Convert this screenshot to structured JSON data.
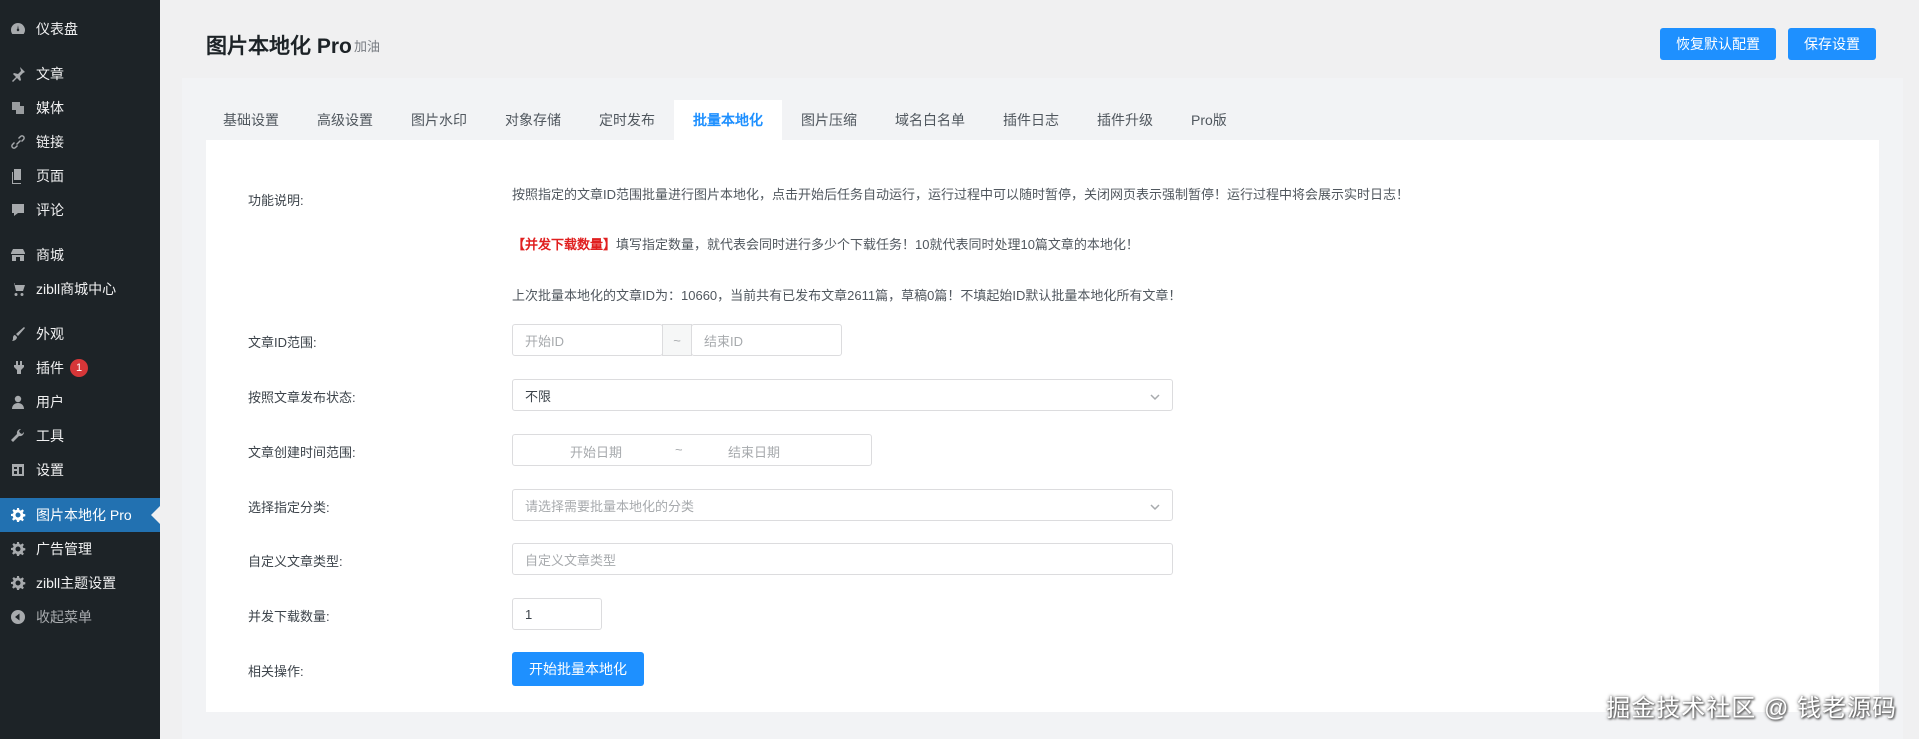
{
  "sidebar": {
    "items": [
      {
        "label": "仪表盘",
        "icon": "dashboard-icon"
      },
      {
        "label": "文章",
        "icon": "pin-icon"
      },
      {
        "label": "媒体",
        "icon": "media-icon"
      },
      {
        "label": "链接",
        "icon": "link-icon"
      },
      {
        "label": "页面",
        "icon": "page-icon"
      },
      {
        "label": "评论",
        "icon": "comment-icon"
      },
      {
        "label": "商城",
        "icon": "store-icon"
      },
      {
        "label": "zibll商城中心",
        "icon": "cart-icon"
      },
      {
        "label": "外观",
        "icon": "brush-icon"
      },
      {
        "label": "插件",
        "icon": "plugin-icon",
        "badge": "1"
      },
      {
        "label": "用户",
        "icon": "user-icon"
      },
      {
        "label": "工具",
        "icon": "wrench-icon"
      },
      {
        "label": "设置",
        "icon": "settings-icon"
      },
      {
        "label": "图片本地化 Pro",
        "icon": "gear-icon",
        "active": true
      },
      {
        "label": "广告管理",
        "icon": "gear-icon"
      },
      {
        "label": "zibll主题设置",
        "icon": "gear-icon"
      },
      {
        "label": "收起菜单",
        "icon": "collapse-icon"
      }
    ]
  },
  "header": {
    "title": "图片本地化 Pro",
    "subtitle": "加油",
    "restore_label": "恢复默认配置",
    "save_label": "保存设置"
  },
  "tabs": [
    "基础设置",
    "高级设置",
    "图片水印",
    "对象存储",
    "定时发布",
    "批量本地化",
    "图片压缩",
    "域名白名单",
    "插件日志",
    "插件升级",
    "Pro版"
  ],
  "active_tab": "批量本地化",
  "form": {
    "func_label": "功能说明:",
    "desc1": "按照指定的文章ID范围批量进行图片本地化，点击开始后任务自动运行，运行过程中可以随时暂停，关闭网页表示强制暂停！运行过程中将会展示实时日志！",
    "desc2_red": "【并发下载数量】",
    "desc2_rest": "填写指定数量，就代表会同时进行多少个下载任务！10就代表同时处理10篇文章的本地化！",
    "desc3": "上次批量本地化的文章ID为：10660，当前共有已发布文章2611篇，草稿0篇！不填起始ID默认批量本地化所有文章！",
    "id_range_label": "文章ID范围:",
    "start_id_placeholder": "开始ID",
    "range_sep": "~",
    "end_id_placeholder": "结束ID",
    "status_label": "按照文章发布状态:",
    "status_value": "不限",
    "date_label": "文章创建时间范围:",
    "start_date_placeholder": "开始日期",
    "date_sep": "~",
    "end_date_placeholder": "结束日期",
    "category_label": "选择指定分类:",
    "category_placeholder": "请选择需要批量本地化的分类",
    "post_type_label": "自定义文章类型:",
    "post_type_placeholder": "自定义文章类型",
    "concurrency_label": "并发下载数量:",
    "concurrency_value": "1",
    "actions_label": "相关操作:",
    "start_button": "开始批量本地化"
  },
  "watermark": "掘金技术社区 @ 钱老源码",
  "colors": {
    "accent": "#1e90ff",
    "sidebar_bg": "#1d2327",
    "active_bg": "#2271b1",
    "badge": "#d63638"
  }
}
